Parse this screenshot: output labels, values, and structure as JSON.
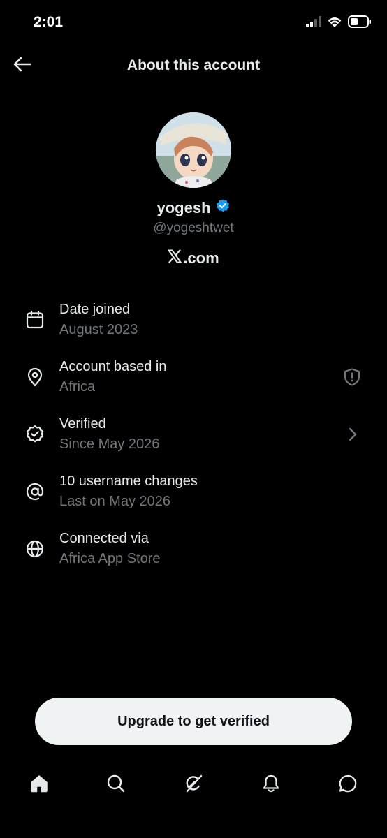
{
  "status_bar": {
    "time": "2:01",
    "icons": [
      "cellular-signal-icon",
      "wifi-icon",
      "battery-icon"
    ]
  },
  "header": {
    "title": "About this account",
    "back_icon": "back-arrow-icon"
  },
  "profile": {
    "display_name": "yogesh",
    "verified_badge": true,
    "badge_color": "#1d9bf0",
    "handle": "@yogeshtwet",
    "site": ".com",
    "site_logo": "x-logo-icon"
  },
  "info": [
    {
      "icon": "calendar-icon",
      "title": "Date joined",
      "subtitle": "August 2023"
    },
    {
      "icon": "location-pin-icon",
      "title": "Account based in",
      "subtitle": "Africa",
      "trailing_icon": "shield-alert-icon"
    },
    {
      "icon": "verified-check-icon",
      "title": "Verified",
      "subtitle": "Since May 2026",
      "trailing_icon": "chevron-right-icon"
    },
    {
      "icon": "at-sign-icon",
      "title": "10 username changes",
      "subtitle": "Last on May 2026"
    },
    {
      "icon": "globe-icon",
      "title": "Connected via",
      "subtitle": "Africa App Store"
    }
  ],
  "upgrade_button": {
    "label": "Upgrade to get verified"
  },
  "bottom_nav": [
    "home-icon",
    "search-icon",
    "grok-icon",
    "notifications-icon",
    "messages-icon"
  ],
  "colors": {
    "background": "#000000",
    "text_primary": "#e7e9ea",
    "text_secondary": "#71767b",
    "button_bg": "#eff3f4"
  }
}
